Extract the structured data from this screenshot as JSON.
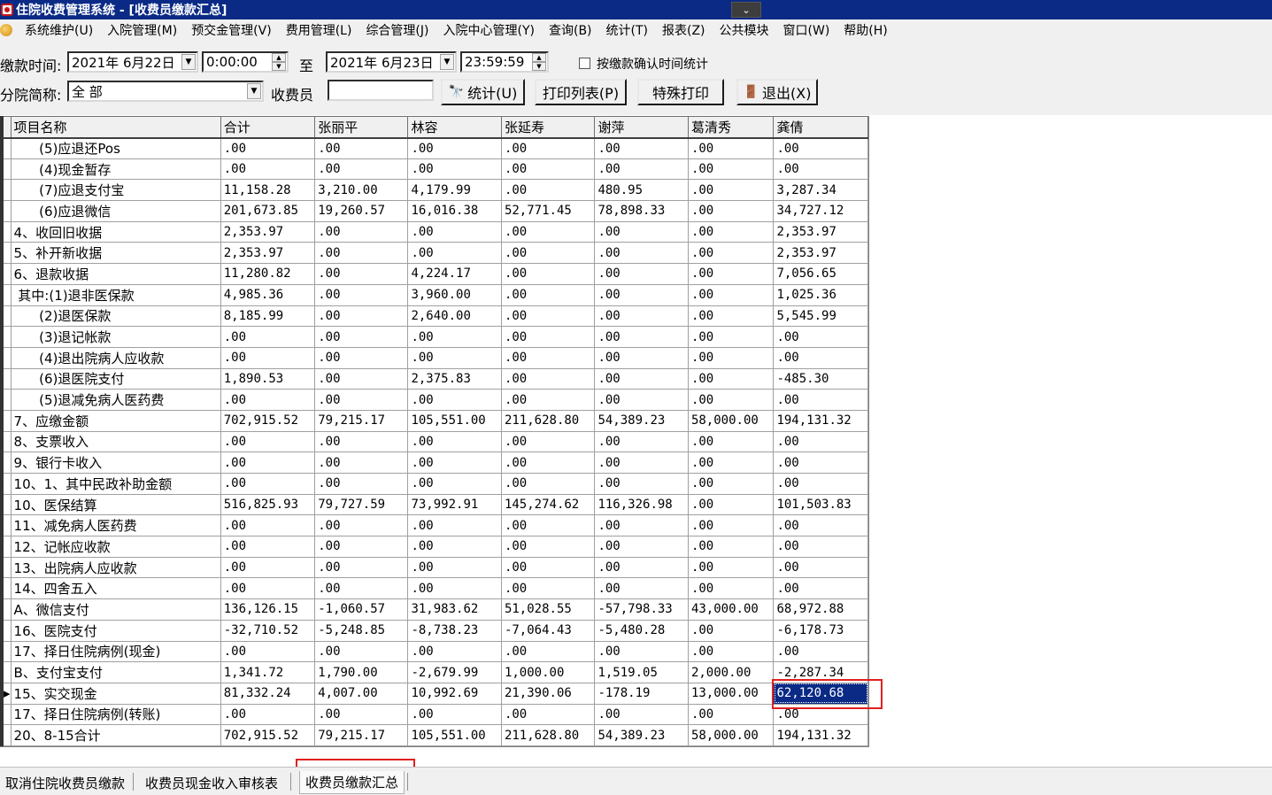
{
  "window": {
    "title": "住院收费管理系统 - [收费员缴款汇总]"
  },
  "menu": [
    "系统维护(U)",
    "入院管理(M)",
    "预交金管理(V)",
    "费用管理(L)",
    "综合管理(J)",
    "入院中心管理(Y)",
    "查询(B)",
    "统计(T)",
    "报表(Z)",
    "公共模块",
    "窗口(W)",
    "帮助(H)"
  ],
  "filters": {
    "payment_time_label": "缴款时间:",
    "start_date": "2021年 6月22日",
    "start_time": "0:00:00",
    "to_label": "至",
    "end_date": "2021年 6月23日",
    "end_time": "23:59:59",
    "confirm_time_checkbox_label": "按缴款确认时间统计",
    "confirm_time_checked": false,
    "branch_label": "分院简称:",
    "branch_value": "全 部",
    "cashier_label": "收费员",
    "cashier_value": ""
  },
  "buttons": {
    "stats": "统计(U)",
    "print_list": "打印列表(P)",
    "special_print": "特殊打印",
    "exit": "退出(X)"
  },
  "table": {
    "columns": [
      "项目名称",
      "合计",
      "张丽平",
      "林容",
      "张延寿",
      "谢萍",
      "葛清秀",
      "龚倩"
    ],
    "rows": [
      [
        "      (5)应退还Pos",
        ".00",
        ".00",
        ".00",
        ".00",
        ".00",
        ".00",
        ".00"
      ],
      [
        "      (4)现金暂存",
        ".00",
        ".00",
        ".00",
        ".00",
        ".00",
        ".00",
        ".00"
      ],
      [
        "      (7)应退支付宝",
        "11,158.28",
        "3,210.00",
        "4,179.99",
        ".00",
        "480.95",
        ".00",
        "3,287.34"
      ],
      [
        "      (6)应退微信",
        "201,673.85",
        "19,260.57",
        "16,016.38",
        "52,771.45",
        "78,898.33",
        ".00",
        "34,727.12"
      ],
      [
        "4、收回旧收据",
        "2,353.97",
        ".00",
        ".00",
        ".00",
        ".00",
        ".00",
        "2,353.97"
      ],
      [
        "5、补开新收据",
        "2,353.97",
        ".00",
        ".00",
        ".00",
        ".00",
        ".00",
        "2,353.97"
      ],
      [
        "6、退款收据",
        "11,280.82",
        ".00",
        "4,224.17",
        ".00",
        ".00",
        ".00",
        "7,056.65"
      ],
      [
        " 其中:(1)退非医保款",
        "4,985.36",
        ".00",
        "3,960.00",
        ".00",
        ".00",
        ".00",
        "1,025.36"
      ],
      [
        "      (2)退医保款",
        "8,185.99",
        ".00",
        "2,640.00",
        ".00",
        ".00",
        ".00",
        "5,545.99"
      ],
      [
        "      (3)退记帐款",
        ".00",
        ".00",
        ".00",
        ".00",
        ".00",
        ".00",
        ".00"
      ],
      [
        "      (4)退出院病人应收款",
        ".00",
        ".00",
        ".00",
        ".00",
        ".00",
        ".00",
        ".00"
      ],
      [
        "      (6)退医院支付",
        "1,890.53",
        ".00",
        "2,375.83",
        ".00",
        ".00",
        ".00",
        "-485.30"
      ],
      [
        "      (5)退减免病人医药费",
        ".00",
        ".00",
        ".00",
        ".00",
        ".00",
        ".00",
        ".00"
      ],
      [
        "7、应缴金额",
        "702,915.52",
        "79,215.17",
        "105,551.00",
        "211,628.80",
        "54,389.23",
        "58,000.00",
        "194,131.32"
      ],
      [
        "8、支票收入",
        ".00",
        ".00",
        ".00",
        ".00",
        ".00",
        ".00",
        ".00"
      ],
      [
        "9、银行卡收入",
        ".00",
        ".00",
        ".00",
        ".00",
        ".00",
        ".00",
        ".00"
      ],
      [
        "10、1、其中民政补助金额",
        ".00",
        ".00",
        ".00",
        ".00",
        ".00",
        ".00",
        ".00"
      ],
      [
        "10、医保结算",
        "516,825.93",
        "79,727.59",
        "73,992.91",
        "145,274.62",
        "116,326.98",
        ".00",
        "101,503.83"
      ],
      [
        "11、减免病人医药费",
        ".00",
        ".00",
        ".00",
        ".00",
        ".00",
        ".00",
        ".00"
      ],
      [
        "12、记帐应收款",
        ".00",
        ".00",
        ".00",
        ".00",
        ".00",
        ".00",
        ".00"
      ],
      [
        "13、出院病人应收款",
        ".00",
        ".00",
        ".00",
        ".00",
        ".00",
        ".00",
        ".00"
      ],
      [
        "14、四舍五入",
        ".00",
        ".00",
        ".00",
        ".00",
        ".00",
        ".00",
        ".00"
      ],
      [
        "A、微信支付",
        "136,126.15",
        "-1,060.57",
        "31,983.62",
        "51,028.55",
        "-57,798.33",
        "43,000.00",
        "68,972.88"
      ],
      [
        "16、医院支付",
        "-32,710.52",
        "-5,248.85",
        "-8,738.23",
        "-7,064.43",
        "-5,480.28",
        ".00",
        "-6,178.73"
      ],
      [
        "17、择日住院病例(现金)",
        ".00",
        ".00",
        ".00",
        ".00",
        ".00",
        ".00",
        ".00"
      ],
      [
        "B、支付宝支付",
        "1,341.72",
        "1,790.00",
        "-2,679.99",
        "1,000.00",
        "1,519.05",
        "2,000.00",
        "-2,287.34"
      ],
      [
        "15、实交现金",
        "81,332.24",
        "4,007.00",
        "10,992.69",
        "21,390.06",
        "-178.19",
        "13,000.00",
        "62,120.68"
      ],
      [
        "17、择日住院病例(转账)",
        ".00",
        ".00",
        ".00",
        ".00",
        ".00",
        ".00",
        ".00"
      ],
      [
        "20、8-15合计",
        "702,915.52",
        "79,215.17",
        "105,551.00",
        "211,628.80",
        "54,389.23",
        "58,000.00",
        "194,131.32"
      ]
    ],
    "selected_row": 26,
    "selected_col": 7
  },
  "tabs": [
    "取消住院收费员缴款",
    "收费员现金收入审核表",
    "收费员缴款汇总"
  ],
  "active_tab": 2,
  "colors": {
    "title_bar": "#0a2a86",
    "highlight_box": "#e02020",
    "selection": "#0a2a86"
  }
}
